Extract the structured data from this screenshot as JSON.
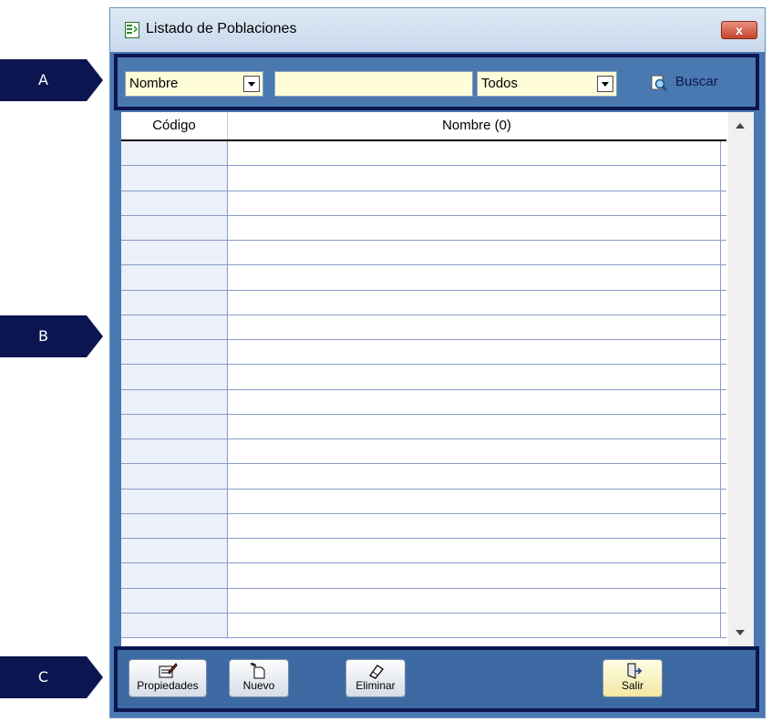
{
  "callouts": [
    {
      "label": "A"
    },
    {
      "label": "B"
    },
    {
      "label": "C"
    }
  ],
  "window": {
    "title": "Listado de Poblaciones",
    "close_symbol": "x"
  },
  "filter_bar": {
    "field_select": {
      "value": "Nombre"
    },
    "search_text": {
      "value": ""
    },
    "scope_select": {
      "value": "Todos"
    },
    "search_button": {
      "label": "Buscar",
      "icon": "search-icon"
    }
  },
  "grid": {
    "columns": [
      "Código",
      "Nombre (0)"
    ],
    "rows": []
  },
  "toolbar": {
    "properties": {
      "label": "Propiedades",
      "icon": "edit-icon"
    },
    "new": {
      "label": "Nuevo",
      "icon": "new-document-icon"
    },
    "delete": {
      "label": "Eliminar",
      "icon": "eraser-icon"
    },
    "exit": {
      "label": "Salir",
      "icon": "exit-door-icon"
    }
  },
  "colors": {
    "callout": "#0b1650",
    "window_body": "#4a78b0",
    "input_bg": "#fffdd8",
    "code_column_bg": "#ebf0fa"
  }
}
